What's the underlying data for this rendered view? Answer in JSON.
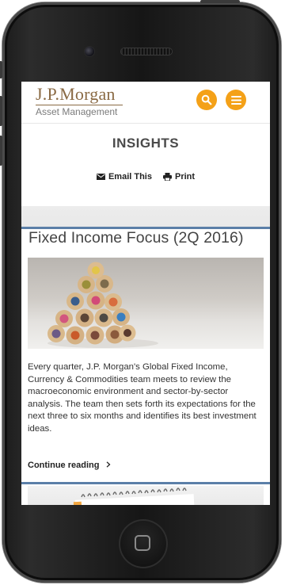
{
  "header": {
    "logo_top": "J.P.Morgan",
    "logo_sub": "Asset Management",
    "search_icon": "search-icon",
    "menu_icon": "hamburger-menu-icon",
    "accent_color": "#f4a118"
  },
  "page": {
    "section_title": "INSIGHTS",
    "email_label": "Email This",
    "print_label": "Print"
  },
  "article": {
    "title": "Fixed Income Focus (2Q 2016)",
    "summary": "Every quarter, J.P. Morgan's Global Fixed Income, Currency & Commodities team meets to review the macroeconomic environment and sector-by-sector analysis. The team then sets forth its expectations for the next three to six months and identifies its best investment ideas.",
    "continue_label": "Continue reading",
    "continue_icon": "chevron-right-icon",
    "rule_color": "#5b7fa8"
  }
}
